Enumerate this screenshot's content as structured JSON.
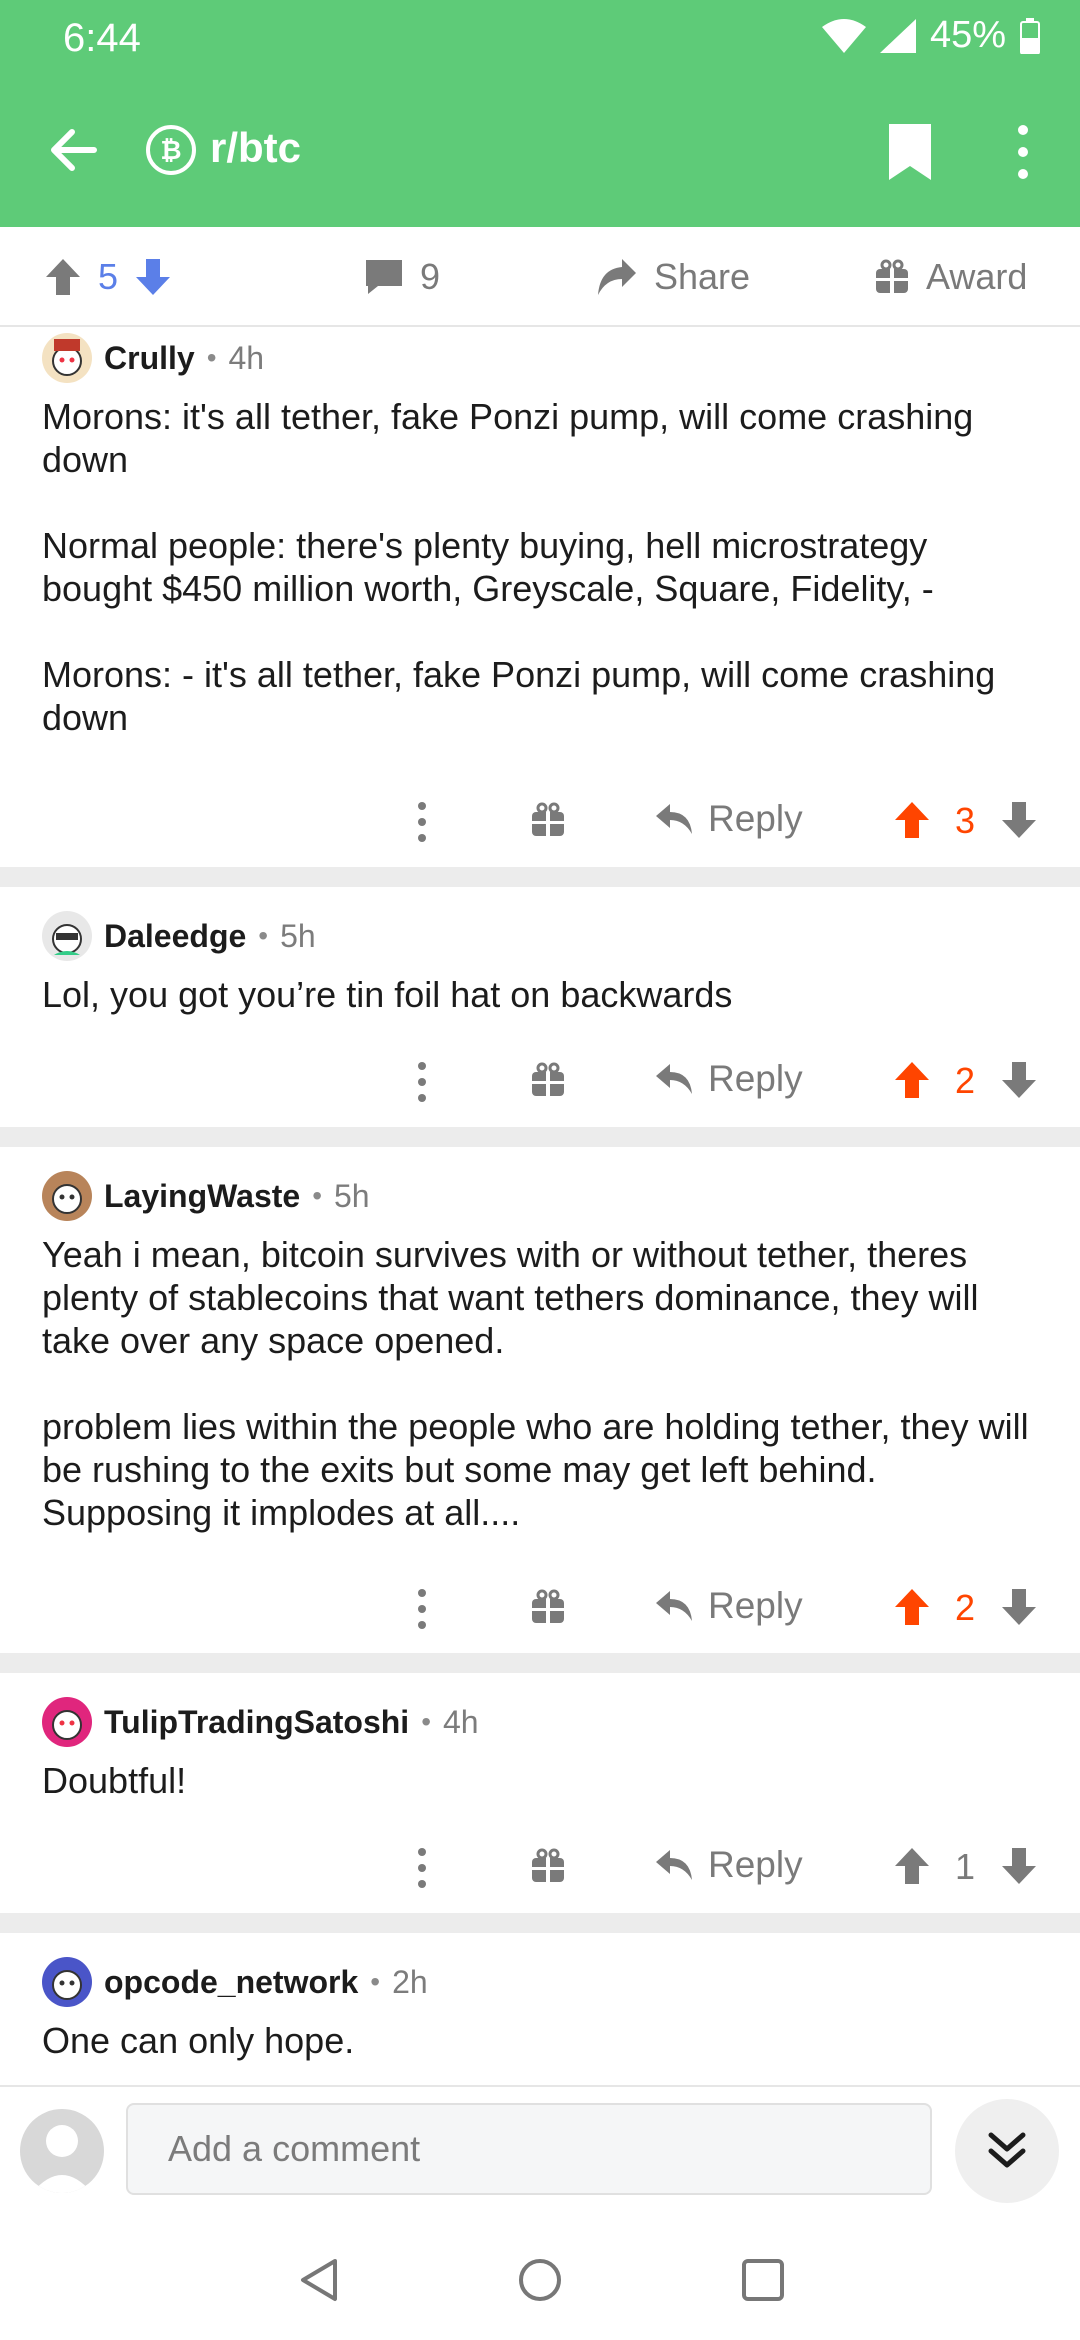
{
  "status": {
    "time": "6:44",
    "battery": "45%"
  },
  "appbar": {
    "subreddit": "r/btc",
    "sub_icon_letter": "₿"
  },
  "actionbar": {
    "score": "5",
    "comments": "9",
    "share_label": "Share",
    "award_label": "Award"
  },
  "comments": [
    {
      "author": "Crully",
      "age": "4h",
      "paragraphs": [
        "Morons: it's all tether, fake Ponzi pump, will come crashing down",
        "Normal people: there's plenty buying, hell microstrategy bought $450 million worth, Greyscale, Square, Fidelity, -",
        "Morons: - it's all tether, fake Ponzi pump, will come crashing down"
      ],
      "reply_label": "Reply",
      "score": "3",
      "upvoted": true
    },
    {
      "author": "Daleedge",
      "age": "5h",
      "paragraphs": [
        "Lol, you got you’re tin foil hat on backwards"
      ],
      "reply_label": "Reply",
      "score": "2",
      "upvoted": true
    },
    {
      "author": "LayingWaste",
      "age": "5h",
      "paragraphs": [
        "Yeah i mean, bitcoin survives with or without tether, theres plenty of stablecoins that want tethers dominance, they will take over any space opened.",
        "problem lies within the people who are holding tether, they will be rushing to the exits but some may get left behind. Supposing it implodes at all...."
      ],
      "reply_label": "Reply",
      "score": "2",
      "upvoted": true
    },
    {
      "author": "TulipTradingSatoshi",
      "age": "4h",
      "paragraphs": [
        "Doubtful!"
      ],
      "reply_label": "Reply",
      "score": "1",
      "upvoted": false
    },
    {
      "author": "opcode_network",
      "age": "2h",
      "paragraphs": [
        "One can only hope."
      ]
    }
  ],
  "composer": {
    "placeholder": "Add a comment"
  },
  "colors": {
    "header_green": "#5ecb78",
    "upvote_orange": "#ff4500",
    "post_vote_blue": "#5b7fe8"
  },
  "icons": [
    "back-arrow-icon",
    "bitcoin-icon",
    "bookmark-icon",
    "more-vertical-icon",
    "upvote-icon",
    "downvote-icon",
    "comment-icon",
    "share-icon",
    "gift-icon",
    "reply-icon",
    "chevron-double-down-icon",
    "nav-back-icon",
    "nav-home-icon",
    "nav-recents-icon"
  ]
}
